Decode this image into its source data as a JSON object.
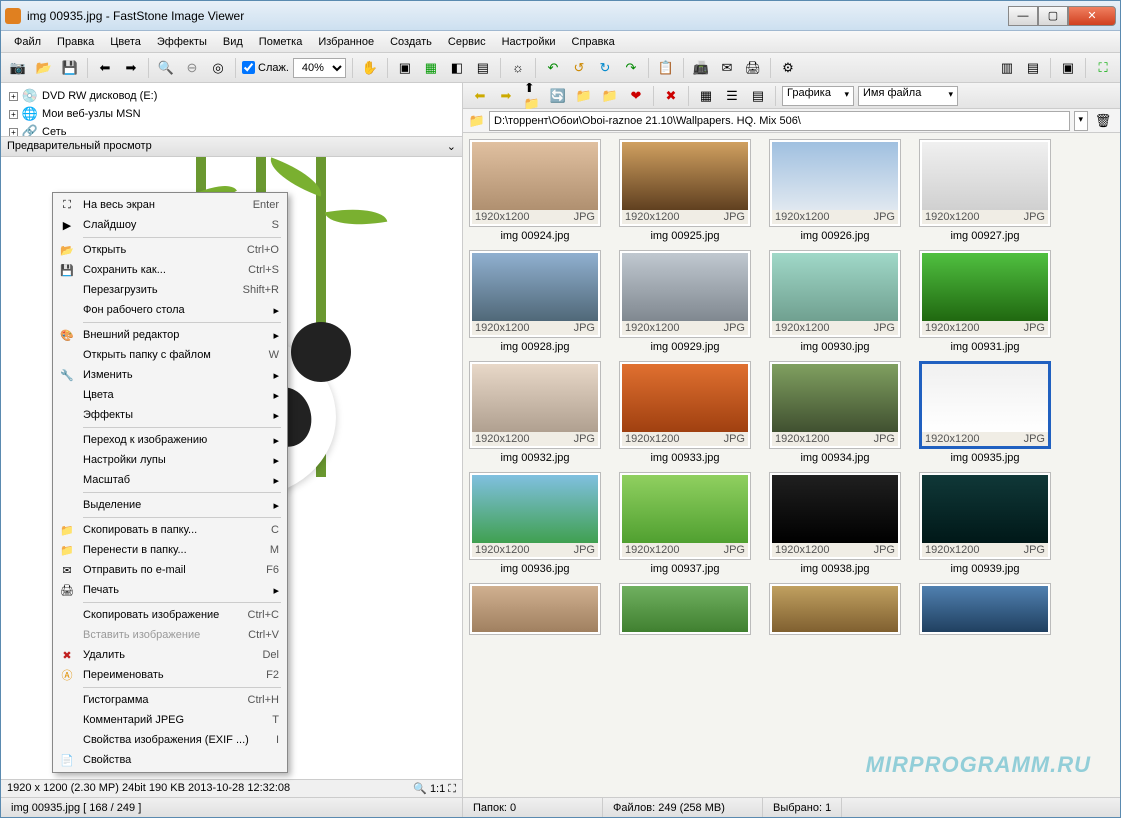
{
  "title": "img 00935.jpg  -  FastStone Image Viewer",
  "menu": [
    "Файл",
    "Правка",
    "Цвета",
    "Эффекты",
    "Вид",
    "Пометка",
    "Избранное",
    "Создать",
    "Сервис",
    "Настройки",
    "Справка"
  ],
  "toolbar": {
    "smooth": "Слаж.",
    "zoom": "40%"
  },
  "tree": [
    {
      "icon": "💿",
      "label": "DVD RW дисковод (E:)"
    },
    {
      "icon": "🌐",
      "label": "Мои веб-узлы MSN"
    },
    {
      "icon": "🔗",
      "label": "Сеть"
    }
  ],
  "preview_header": "Предварительный просмотр",
  "preview_status_left": "1920 x 1200 (2.30 MP)  24bit  190 KB  2013-10-28 12:32:08",
  "preview_status_right": "1:1",
  "nav": {
    "view_mode": "Графика",
    "sort": "Имя файла"
  },
  "path": "D:\\торрент\\Обои\\Oboi-raznoe 21.10\\Wallpapers. HQ. Mix 506\\",
  "thumbs": [
    {
      "dim": "1920x1200",
      "fmt": "JPG",
      "name": "img 00924.jpg",
      "g": "linear-gradient(#e0c0a0,#b09070)"
    },
    {
      "dim": "1920x1200",
      "fmt": "JPG",
      "name": "img 00925.jpg",
      "g": "linear-gradient(#d0a060,#604020)"
    },
    {
      "dim": "1920x1200",
      "fmt": "JPG",
      "name": "img 00926.jpg",
      "g": "linear-gradient(#a0c0e0,#e0e8f0)"
    },
    {
      "dim": "1920x1200",
      "fmt": "JPG",
      "name": "img 00927.jpg",
      "g": "linear-gradient(#f0f0f0,#d0d0d0)"
    },
    {
      "dim": "1920x1200",
      "fmt": "JPG",
      "name": "img 00928.jpg",
      "g": "linear-gradient(#90b0d0,#506878)"
    },
    {
      "dim": "1920x1200",
      "fmt": "JPG",
      "name": "img 00929.jpg",
      "g": "linear-gradient(#c0c8d0,#808890)"
    },
    {
      "dim": "1920x1200",
      "fmt": "JPG",
      "name": "img 00930.jpg",
      "g": "linear-gradient(#a0d8c8,#70a090)"
    },
    {
      "dim": "1920x1200",
      "fmt": "JPG",
      "name": "img 00931.jpg",
      "g": "linear-gradient(#50c040,#206810)"
    },
    {
      "dim": "1920x1200",
      "fmt": "JPG",
      "name": "img 00932.jpg",
      "g": "linear-gradient(#e8d8c8,#b0a090)"
    },
    {
      "dim": "1920x1200",
      "fmt": "JPG",
      "name": "img 00933.jpg",
      "g": "linear-gradient(#e07030,#a04010)"
    },
    {
      "dim": "1920x1200",
      "fmt": "JPG",
      "name": "img 00934.jpg",
      "g": "linear-gradient(#80a060,#405030)"
    },
    {
      "dim": "1920x1200",
      "fmt": "JPG",
      "name": "img 00935.jpg",
      "sel": true,
      "g": "linear-gradient(#f0f0f0,#ffffff)"
    },
    {
      "dim": "1920x1200",
      "fmt": "JPG",
      "name": "img 00936.jpg",
      "g": "linear-gradient(#80c0e0,#40a050)"
    },
    {
      "dim": "1920x1200",
      "fmt": "JPG",
      "name": "img 00937.jpg",
      "g": "linear-gradient(#90d060,#50a030)"
    },
    {
      "dim": "1920x1200",
      "fmt": "JPG",
      "name": "img 00938.jpg",
      "g": "linear-gradient(#202020,#000000)"
    },
    {
      "dim": "1920x1200",
      "fmt": "JPG",
      "name": "img 00939.jpg",
      "g": "linear-gradient(#103838,#001818)"
    },
    {
      "dim": "",
      "fmt": "",
      "name": "",
      "g": "linear-gradient(#d0b090,#a08060)",
      "partial": true
    },
    {
      "dim": "",
      "fmt": "",
      "name": "",
      "g": "linear-gradient(#70b060,#408030)",
      "partial": true
    },
    {
      "dim": "",
      "fmt": "",
      "name": "",
      "g": "linear-gradient(#c0a060,#806030)",
      "partial": true
    },
    {
      "dim": "",
      "fmt": "",
      "name": "",
      "g": "linear-gradient(#5080b0,#204060)",
      "partial": true
    }
  ],
  "ctx": [
    {
      "icon": "⛶",
      "label": "На весь экран",
      "short": "Enter"
    },
    {
      "icon": "▶",
      "label": "Слайдшоу",
      "short": "S"
    },
    {
      "sep": true
    },
    {
      "icon": "📂",
      "label": "Открыть",
      "short": "Ctrl+O"
    },
    {
      "icon": "💾",
      "label": "Сохранить как...",
      "short": "Ctrl+S"
    },
    {
      "label": "Перезагрузить",
      "short": "Shift+R"
    },
    {
      "label": "Фон рабочего стола",
      "sub": true
    },
    {
      "sep": true
    },
    {
      "icon": "🎨",
      "label": "Внешний редактор",
      "sub": true
    },
    {
      "label": "Открыть папку с файлом",
      "short": "W"
    },
    {
      "icon": "🔧",
      "label": "Изменить",
      "sub": true
    },
    {
      "label": "Цвета",
      "sub": true
    },
    {
      "label": "Эффекты",
      "sub": true
    },
    {
      "sep": true
    },
    {
      "label": "Переход к изображению",
      "sub": true
    },
    {
      "label": "Настройки лупы",
      "sub": true
    },
    {
      "label": "Масштаб",
      "sub": true
    },
    {
      "sep": true
    },
    {
      "label": "Выделение",
      "sub": true
    },
    {
      "sep": true
    },
    {
      "icon": "📁",
      "label": "Скопировать в папку...",
      "short": "C"
    },
    {
      "icon": "📁",
      "label": "Перенести в папку...",
      "short": "M"
    },
    {
      "icon": "✉",
      "label": "Отправить по e-mail",
      "short": "F6"
    },
    {
      "icon": "🖨",
      "label": "Печать",
      "sub": true
    },
    {
      "sep": true
    },
    {
      "label": "Скопировать изображение",
      "short": "Ctrl+C"
    },
    {
      "label": "Вставить изображение",
      "short": "Ctrl+V",
      "disabled": true
    },
    {
      "icon": "✖",
      "label": "Удалить",
      "short": "Del",
      "iconColor": "#c02020"
    },
    {
      "icon": "Ⓐ",
      "label": "Переименовать",
      "short": "F2",
      "iconColor": "#e09000"
    },
    {
      "sep": true
    },
    {
      "label": "Гистограмма",
      "short": "Ctrl+H"
    },
    {
      "label": "Комментарий JPEG",
      "short": "T"
    },
    {
      "label": "Свойства изображения (EXIF ...)",
      "short": "I"
    },
    {
      "icon": "📄",
      "label": "Свойства"
    }
  ],
  "status": {
    "left": "img 00935.jpg  [ 168 / 249 ]",
    "folders": "Папок: 0",
    "files": "Файлов: 249 (258 MB)",
    "selected": "Выбрано: 1"
  },
  "watermark": "MIRPROGRAMM.RU"
}
